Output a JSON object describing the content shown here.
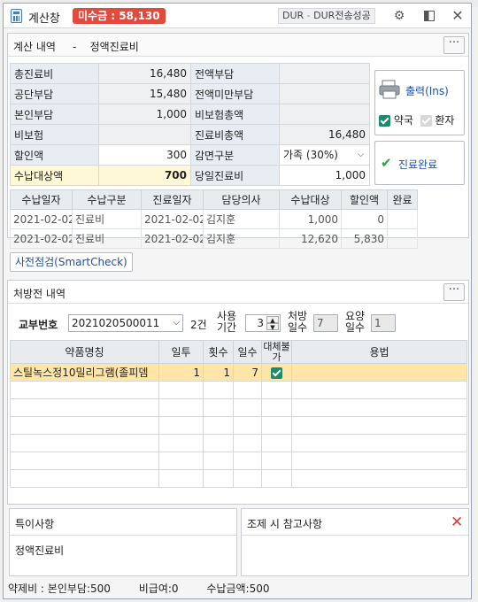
{
  "window": {
    "title": "계산창",
    "unpaid_badge": "미수금 : 58,130",
    "dur_label": "DUR",
    "dur_status": "DUR전송성공",
    "icons": [
      "settings-icon",
      "restore-icon",
      "close-icon"
    ]
  },
  "billing": {
    "header": "계산 내역     -    정액진료비",
    "more": "···",
    "rows": [
      {
        "l1": "총진료비",
        "v1": "16,480",
        "l2": "전액부담",
        "v2": ""
      },
      {
        "l1": "공단부담",
        "v1": "15,480",
        "l2": "전액미만부담",
        "v2": ""
      },
      {
        "l1": "본인부담",
        "v1": "1,000",
        "l2": "비보험총액",
        "v2": ""
      },
      {
        "l1": "비보험",
        "v1": "",
        "l2": "진료비총액",
        "v2": "16,480"
      },
      {
        "l1": "할인액",
        "v1": "300",
        "l2": "감면구분",
        "v2": "가족 (30%)"
      },
      {
        "l1": "수납대상액",
        "v1": "700",
        "l2": "당일진료비",
        "v2": "1,000"
      }
    ],
    "print_button": "출력(Ins)",
    "pharmacy_label": "약국",
    "patient_label": "환자",
    "complete_button": "진료완료"
  },
  "payments": {
    "headers": [
      "수납일자",
      "수납구분",
      "진료일자",
      "담당의사",
      "수납대상",
      "할인액",
      "완료"
    ],
    "rows": [
      [
        "2021-02-02",
        "진료비",
        "2021-02-02",
        "김지훈",
        "1,000",
        "0",
        ""
      ],
      [
        "2021-02-02",
        "진료비",
        "2021-02-02",
        "김지훈",
        "12,620",
        "5,830",
        ""
      ]
    ]
  },
  "smartcheck_button": "사전점검(SmartCheck)",
  "prescription": {
    "header": "처방전 내역",
    "more": "···",
    "issue_no_label": "교부번호",
    "issue_no_value": "2021020500011",
    "count": "2건",
    "use_period_label1": "사용",
    "use_period_label2": "기간",
    "use_period_value": "3",
    "rx_days_label1": "처방",
    "rx_days_label2": "일수",
    "rx_days_value": "7",
    "care_days_label1": "요양",
    "care_days_label2": "일수",
    "care_days_value": "1",
    "headers": [
      "약품명칭",
      "일투",
      "횟수",
      "일수",
      "대체불가",
      "용법"
    ],
    "rows": [
      {
        "name": "스틸녹스정10밀리그램(졸피뎀",
        "dose": "1",
        "times": "1",
        "days": "7",
        "no_sub": true,
        "usage": ""
      }
    ]
  },
  "notes": {
    "special_title": "특이사항",
    "special_text": "정액진료비",
    "dispense_title": "조제 시 참고사항",
    "dispense_text": ""
  },
  "footer": {
    "drug_fee": "약제비 : 본인부담:500",
    "non_covered": "비급여:0",
    "collected": "수납금액:500"
  }
}
